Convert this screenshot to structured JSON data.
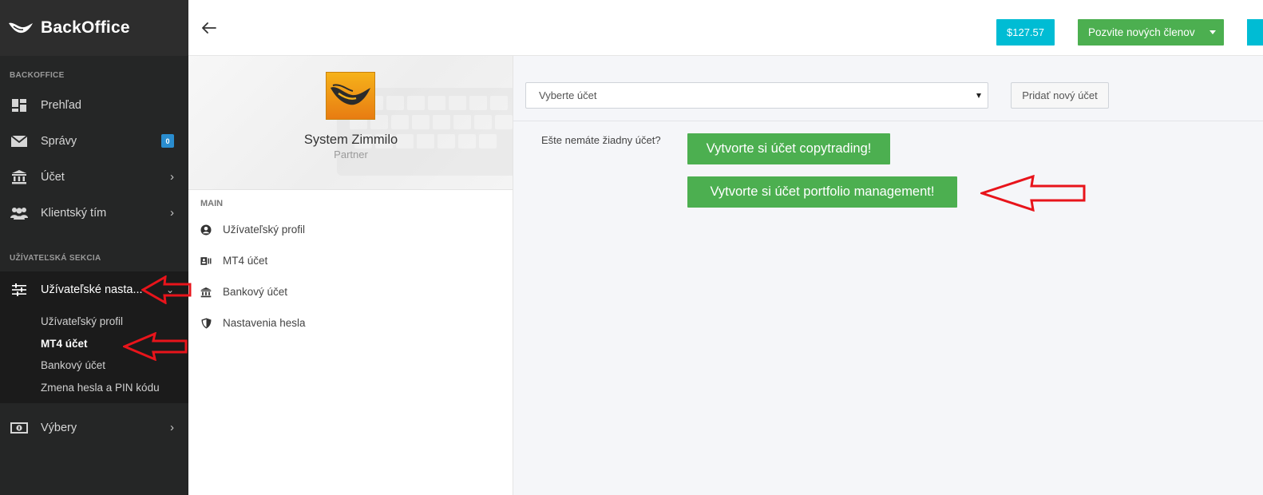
{
  "brand": {
    "title": "BackOffice"
  },
  "sidebar": {
    "section_backoffice": "BACKOFFICE",
    "section_user": "UŽÍVATEĽSKÁ SEKCIA",
    "items": [
      {
        "label": "Prehľad",
        "icon": "dashboard-icon"
      },
      {
        "label": "Správy",
        "icon": "envelope-icon",
        "badge": "0"
      },
      {
        "label": "Účet",
        "icon": "bank-icon",
        "chevron": "›"
      },
      {
        "label": "Klientský tím",
        "icon": "users-icon",
        "chevron": "›"
      }
    ],
    "settings_item": {
      "label": "Užívateľské nasta...",
      "icon": "sliders-icon"
    },
    "submenu": [
      "Užívateľský profil",
      "MT4 účet",
      "Bankový účet",
      "Zmena hesla a PIN kódu"
    ],
    "withdrawals_item": {
      "label": "Výbery",
      "icon": "money-icon",
      "chevron": "›"
    }
  },
  "topbar": {
    "balance": "$127.57",
    "invite_label": "Pozvite nových členov"
  },
  "profile": {
    "name": "System Zimmilo",
    "role": "Partner",
    "menu_heading": "MAIN",
    "menu": [
      {
        "label": "Užívateľský profil",
        "icon": "user-circle-icon"
      },
      {
        "label": "MT4 účet",
        "icon": "id-card-icon"
      },
      {
        "label": "Bankový účet",
        "icon": "bank-icon"
      },
      {
        "label": "Nastavenia hesla",
        "icon": "shield-icon"
      }
    ]
  },
  "content": {
    "select_placeholder": "Vyberte účet",
    "add_account_label": "Pridať nový účet",
    "no_account_text": "Ešte nemáte žiadny účet?",
    "copytrading_label": "Vytvorte si účet copytrading!",
    "portfolio_label": "Vytvorte si účet portfolio management!"
  },
  "colors": {
    "sidebar_bg": "#252626",
    "accent_cyan": "#00bcd4",
    "accent_green": "#4caf50",
    "annotation_red": "#e8141b"
  }
}
